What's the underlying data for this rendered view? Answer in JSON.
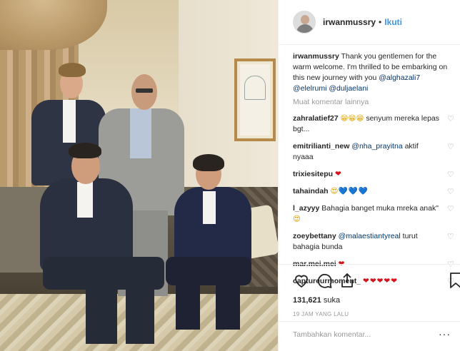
{
  "header": {
    "username": "irwanmussry",
    "separator": "•",
    "follow_label": "Ikuti"
  },
  "caption": {
    "username": "irwanmussry",
    "text": "Thank you gentlemen for the warm welcome. I'm thrilled to be embarking on this new journey with you",
    "mentions": [
      "@alghazali7",
      "@elelrumi",
      "@duljaelani"
    ]
  },
  "load_more_label": "Muat komentar lainnya",
  "comments": [
    {
      "username": "zahralatief27",
      "emoji": "😁😁😁",
      "text": "senyum mereka lepas bgt...",
      "mention": ""
    },
    {
      "username": "emitrilianti_new",
      "emoji": "",
      "mention": "@nha_prayitna",
      "text": "aktif nyaaa"
    },
    {
      "username": "trixiesitepu",
      "emoji": "❤",
      "text": "",
      "mention": ""
    },
    {
      "username": "tahaindah",
      "emoji": "😍",
      "hearts": "💙💙💙",
      "text": "",
      "mention": ""
    },
    {
      "username": "l_azyyy",
      "emoji": "😍",
      "text": "Bahagia banget muka mreka anak\"",
      "mention": ""
    },
    {
      "username": "zoeybettany",
      "emoji": "",
      "mention": "@malaestiantyreal",
      "text": "turut bahagia bunda"
    },
    {
      "username": "mar.mei.mei",
      "emoji": "❤",
      "text": "",
      "mention": ""
    },
    {
      "username": "captureurmoment_",
      "emoji": "❤❤❤❤❤",
      "text": "",
      "mention": ""
    }
  ],
  "likes": {
    "count": "131,621",
    "suffix": "suka"
  },
  "timestamp": "19 JAM YANG LALU",
  "add_comment_placeholder": "Tambahkan komentar...",
  "more_label": "···",
  "colors": {
    "link": "#3897f0",
    "mention": "#003569",
    "muted": "#999999",
    "text": "#262626"
  },
  "icons": [
    "heart-icon",
    "comment-icon",
    "share-icon",
    "bookmark-icon",
    "comment-like-icon"
  ]
}
